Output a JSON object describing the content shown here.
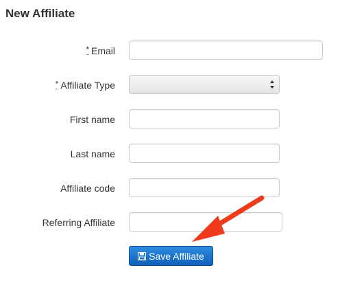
{
  "page": {
    "title": "New Affiliate"
  },
  "form": {
    "required_marker": "*",
    "fields": {
      "email": {
        "label": "Email",
        "value": "",
        "placeholder": ""
      },
      "affiliate_type": {
        "label": "Affiliate Type",
        "selected": ""
      },
      "first_name": {
        "label": "First name",
        "value": "",
        "placeholder": ""
      },
      "last_name": {
        "label": "Last name",
        "value": "",
        "placeholder": ""
      },
      "affiliate_code": {
        "label": "Affiliate code",
        "value": "",
        "placeholder": ""
      },
      "referring_affiliate": {
        "label": "Referring Affiliate",
        "value": "",
        "placeholder": ""
      }
    },
    "submit_label": "Save Affiliate"
  },
  "annotation": {
    "arrow_color": "#f03a1c"
  },
  "icons": {
    "submit_icon": "floppy-disk-icon",
    "select_icon": "select-arrows-icon",
    "annotation": "red-arrow-icon"
  }
}
